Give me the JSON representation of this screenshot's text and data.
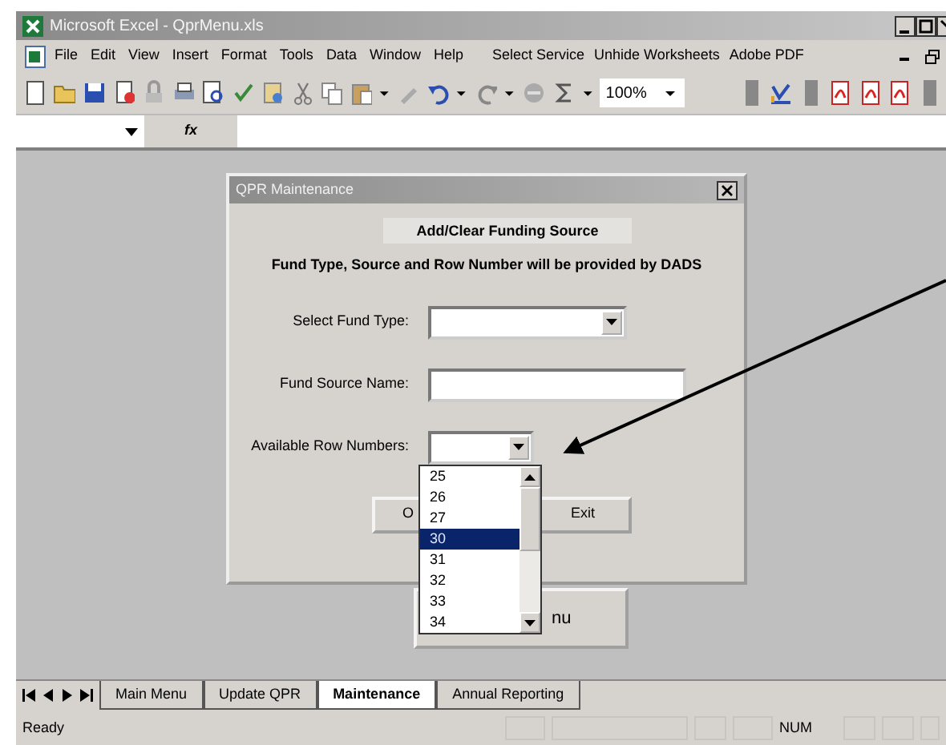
{
  "window": {
    "title": "Microsoft Excel - QprMenu.xls"
  },
  "menu": [
    "File",
    "Edit",
    "View",
    "Insert",
    "Format",
    "Tools",
    "Data",
    "Window",
    "Help",
    "Select Service",
    "Unhide Worksheets",
    "Adobe PDF"
  ],
  "toolbar": {
    "zoom": "100%"
  },
  "formula_bar": {
    "fx": "fx"
  },
  "dialog": {
    "title": "QPR Maintenance",
    "heading": "Add/Clear Funding Source",
    "note": "Fund Type, Source and Row Number will be provided by DADS",
    "fields": [
      {
        "kind": "combo",
        "label": "Select Fund Type:"
      },
      {
        "kind": "text",
        "label": "Fund Source Name:"
      },
      {
        "kind": "combo",
        "label": "Available Row Numbers:"
      }
    ],
    "buttons": [
      "O",
      "Exit"
    ],
    "row_list": {
      "open": true,
      "items": [
        {
          "label": "25",
          "selected": false
        },
        {
          "label": "26",
          "selected": false
        },
        {
          "label": "27",
          "selected": false
        },
        {
          "label": "30",
          "selected": true
        },
        {
          "label": "31",
          "selected": false
        },
        {
          "label": "32",
          "selected": false
        },
        {
          "label": "33",
          "selected": false
        },
        {
          "label": "34",
          "selected": false
        }
      ]
    }
  },
  "sheet_button": {
    "label": "nu"
  },
  "sheet_tabs": [
    {
      "label": "Main Menu",
      "selected": false
    },
    {
      "label": "Update QPR",
      "selected": false
    },
    {
      "label": "Maintenance",
      "selected": true
    },
    {
      "label": "Annual Reporting",
      "selected": false
    }
  ],
  "status_bar": {
    "left": "Ready",
    "indicator": "NUM"
  }
}
